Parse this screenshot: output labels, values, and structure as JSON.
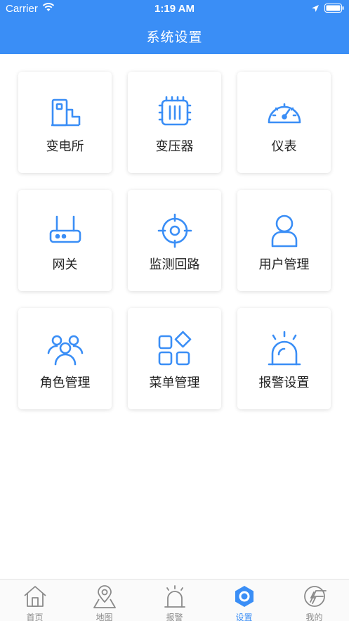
{
  "status_bar": {
    "carrier": "Carrier",
    "time": "1:19 AM"
  },
  "header": {
    "title": "系统设置"
  },
  "colors": {
    "accent": "#3a8ef6",
    "tab_inactive": "#8a8a8a",
    "header_bg": "#3a8ef6"
  },
  "menu": [
    {
      "label": "变电所",
      "icon": "substation-icon"
    },
    {
      "label": "变压器",
      "icon": "transformer-icon"
    },
    {
      "label": "仪表",
      "icon": "gauge-icon"
    },
    {
      "label": "网关",
      "icon": "gateway-router-icon"
    },
    {
      "label": "监测回路",
      "icon": "crosshair-target-icon"
    },
    {
      "label": "用户管理",
      "icon": "user-icon"
    },
    {
      "label": "角色管理",
      "icon": "users-group-icon"
    },
    {
      "label": "菜单管理",
      "icon": "grid-apps-icon"
    },
    {
      "label": "报警设置",
      "icon": "alarm-siren-icon"
    }
  ],
  "tabbar": {
    "active": "设置",
    "tabs": [
      {
        "label": "首页",
        "icon": "home-icon"
      },
      {
        "label": "地图",
        "icon": "map-icon"
      },
      {
        "label": "报警",
        "icon": "siren-icon"
      },
      {
        "label": "设置",
        "icon": "settings-hex-icon"
      },
      {
        "label": "我的",
        "icon": "profile-logo-icon"
      }
    ]
  }
}
